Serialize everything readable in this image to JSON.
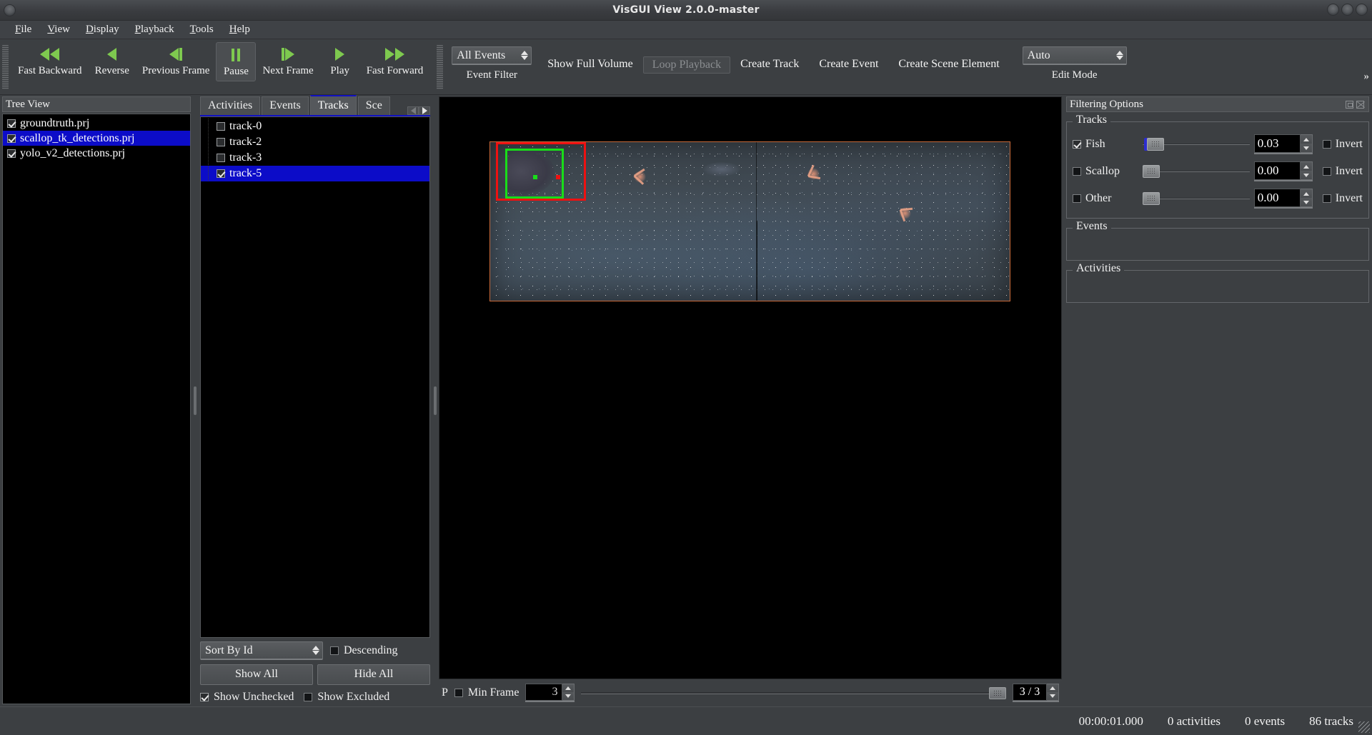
{
  "window": {
    "title": "VisGUI View 2.0.0-master",
    "controls": [
      "minimize",
      "maximize",
      "close"
    ]
  },
  "menubar": {
    "items": [
      {
        "label": "File",
        "mnemonic": "F"
      },
      {
        "label": "View",
        "mnemonic": "V"
      },
      {
        "label": "Display",
        "mnemonic": "D"
      },
      {
        "label": "Playback",
        "mnemonic": "P"
      },
      {
        "label": "Tools",
        "mnemonic": "T"
      },
      {
        "label": "Help",
        "mnemonic": "H"
      }
    ]
  },
  "toolbar": {
    "playback_buttons": [
      {
        "label": "Fast Backward",
        "icon": "fast-backward-icon",
        "active": false
      },
      {
        "label": "Reverse",
        "icon": "reverse-icon",
        "active": false
      },
      {
        "label": "Previous Frame",
        "icon": "previous-frame-icon",
        "active": false
      },
      {
        "label": "Pause",
        "icon": "pause-icon",
        "active": true
      },
      {
        "label": "Next Frame",
        "icon": "next-frame-icon",
        "active": false
      },
      {
        "label": "Play",
        "icon": "play-icon",
        "active": false
      },
      {
        "label": "Fast Forward",
        "icon": "fast-forward-icon",
        "active": false
      }
    ],
    "event_filter": {
      "value": "All Events",
      "caption": "Event Filter"
    },
    "show_full_volume": "Show Full Volume",
    "loop_playback": "Loop Playback",
    "create_track": "Create Track",
    "create_event": "Create Event",
    "create_scene_element": "Create Scene Element",
    "edit_mode": {
      "value": "Auto",
      "caption": "Edit Mode"
    },
    "overflow": "»"
  },
  "treeview": {
    "title": "Tree View",
    "items": [
      {
        "label": "groundtruth.prj",
        "checked": true,
        "selected": false
      },
      {
        "label": "scallop_tk_detections.prj",
        "checked": true,
        "selected": true
      },
      {
        "label": "yolo_v2_detections.prj",
        "checked": true,
        "selected": false
      }
    ]
  },
  "tabs_panel": {
    "tabs": [
      {
        "label": "Activities",
        "selected": false
      },
      {
        "label": "Events",
        "selected": false
      },
      {
        "label": "Tracks",
        "selected": true
      },
      {
        "label": "Sce",
        "selected": false
      }
    ],
    "tracks": [
      {
        "label": "track-0",
        "checked": false,
        "selected": false
      },
      {
        "label": "track-2",
        "checked": false,
        "selected": false
      },
      {
        "label": "track-3",
        "checked": false,
        "selected": false
      },
      {
        "label": "track-5",
        "checked": true,
        "selected": true
      }
    ],
    "sort_by": "Sort By Id",
    "descending": {
      "label": "Descending",
      "checked": false
    },
    "show_all": "Show All",
    "hide_all": "Hide All",
    "show_unchecked": {
      "label": "Show Unchecked",
      "checked": true
    },
    "show_excluded": {
      "label": "Show Excluded",
      "checked": false
    }
  },
  "viewport": {
    "boxes": [
      {
        "name": "detection-box-red",
        "color": "#ee1111"
      },
      {
        "name": "detection-box-green",
        "color": "#19dd19"
      }
    ],
    "frame_border_color": "#c96a3a"
  },
  "playbar": {
    "p_label": "P",
    "min_frame": {
      "label": "Min Frame",
      "checked": false
    },
    "min_frame_value": "3",
    "frame_counter": "3 / 3"
  },
  "filtering": {
    "title": "Filtering Options",
    "tracks_group": "Tracks",
    "rows": [
      {
        "label": "Fish",
        "checked": true,
        "value": "0.03",
        "slider_pct": 3,
        "invert": {
          "label": "Invert",
          "checked": false
        }
      },
      {
        "label": "Scallop",
        "checked": false,
        "value": "0.00",
        "slider_pct": 0,
        "invert": {
          "label": "Invert",
          "checked": false
        }
      },
      {
        "label": "Other",
        "checked": false,
        "value": "0.00",
        "slider_pct": 0,
        "invert": {
          "label": "Invert",
          "checked": false
        }
      }
    ],
    "events_group": "Events",
    "activities_group": "Activities"
  },
  "statusbar": {
    "timestamp": "00:00:01.000",
    "activities": "0 activities",
    "events": "0 events",
    "tracks": "86 tracks"
  }
}
